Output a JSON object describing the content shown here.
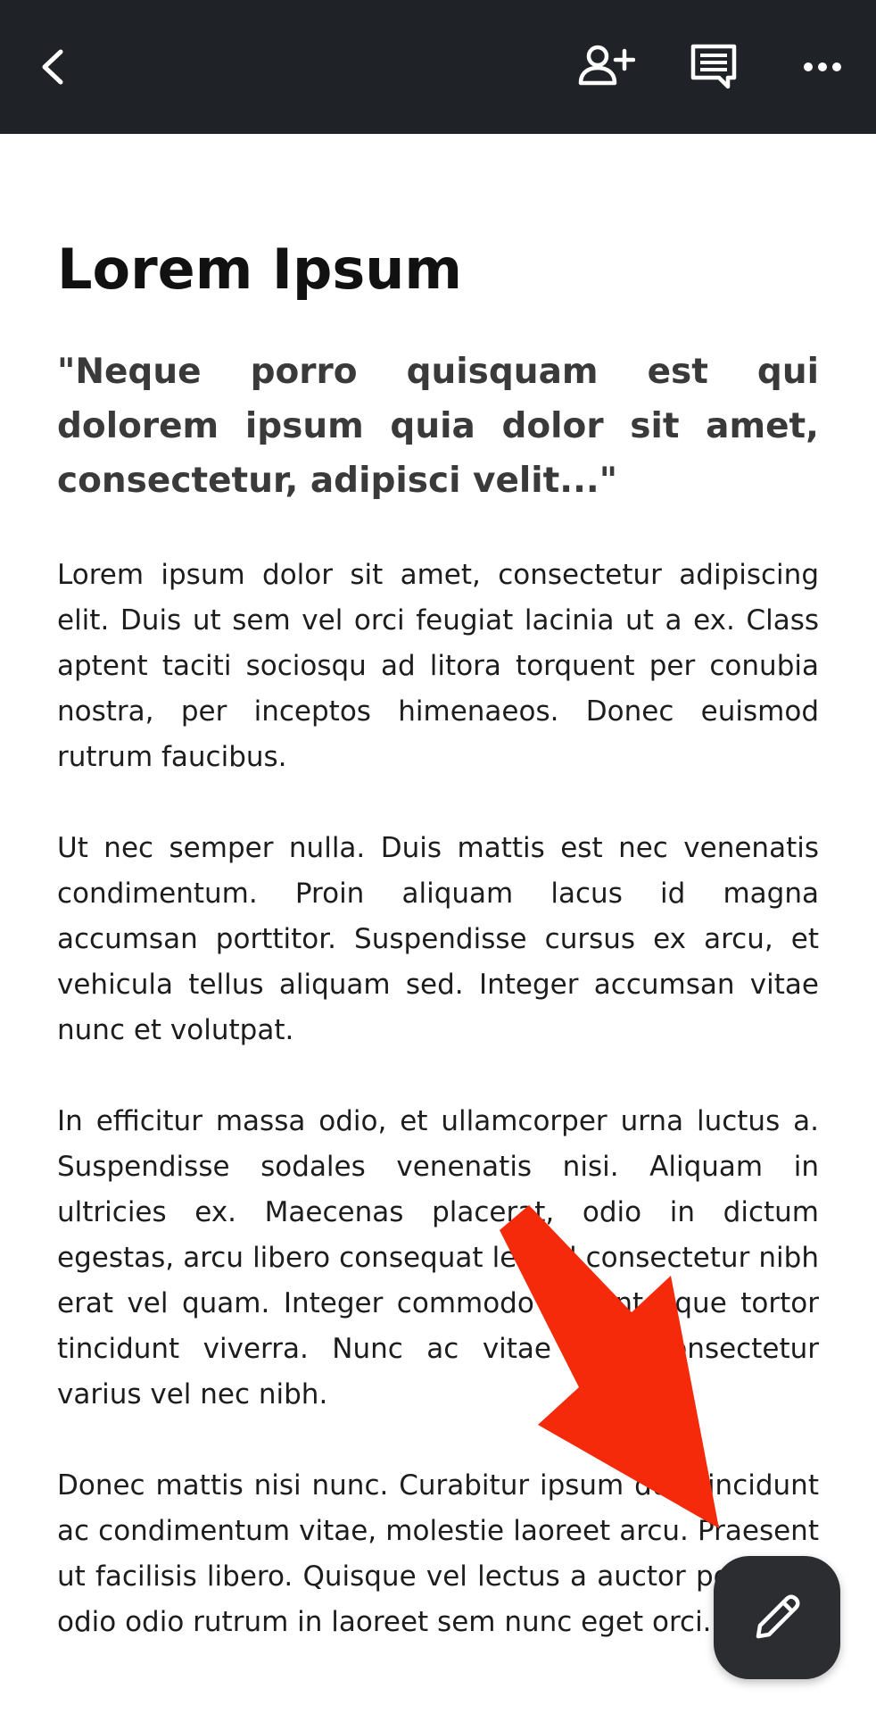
{
  "appbar": {
    "background": "#1f2227",
    "icons": [
      "chevron-left-icon",
      "add-person-icon",
      "comment-icon",
      "more-horizontal-icon"
    ]
  },
  "document": {
    "title": "Lorem Ipsum",
    "quote": "\"Neque porro quisquam est qui dolorem ipsum quia dolor sit amet, consectetur, adipisci velit...\"",
    "paragraphs": [
      "Lorem ipsum dolor sit amet, consectetur adipiscing elit. Duis ut sem vel orci feugiat lacinia ut a ex. Class aptent taciti sociosqu ad litora torquent per conubia nostra, per inceptos himenaeos. Donec euismod rutrum faucibus.",
      "Ut nec semper nulla. Duis mattis est nec venenatis condimentum. Proin aliquam lacus id magna accumsan porttitor. Suspendisse cursus ex arcu, et vehicula tellus aliquam sed. Integer accumsan vitae nunc et volutpat.",
      "In efficitur massa odio, et ullamcorper urna luctus a. Suspendisse sodales venenatis nisi. Aliquam in ultricies ex. Maecenas placerat, odio in dictum egestas, arcu libero consequat leo, id consectetur nibh erat vel quam. Integer commodo pellentesque tortor tincidunt viverra. Nunc ac vitae felis consectetur varius vel nec nibh.",
      "Donec mattis nisi nunc. Curabitur ipsum dui, tincidunt ac condimentum vitae, molestie laoreet arcu. Praesent ut facilisis libero. Quisque vel lectus a auctor porttitor, odio odio rutrum in laoreet sem nunc eget orci."
    ]
  },
  "fab": {
    "icon": "pencil-icon",
    "background": "#2b2d31"
  },
  "annotation": {
    "icon": "red-arrow-icon",
    "color": "#f52a0a"
  }
}
